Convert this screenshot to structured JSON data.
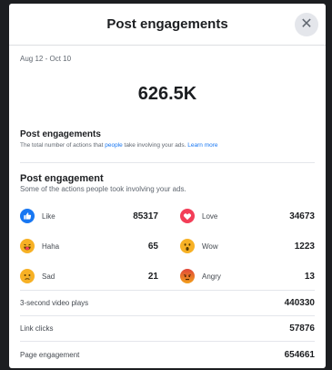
{
  "modal": {
    "title": "Post engagements",
    "close_icon": "close-icon",
    "date_range": "Aug 12 - Oct 10",
    "total": "626.5K"
  },
  "section1": {
    "title": "Post engagements",
    "desc_prefix": "The total number of actions that ",
    "desc_link": "people",
    "desc_suffix": " take involving your ads. ",
    "learn_more": "Learn more"
  },
  "section2": {
    "title": "Post engagement",
    "desc": "Some of the actions people took involving your ads."
  },
  "reactions": [
    {
      "label": "Like",
      "value": "85317",
      "icon": "like-icon"
    },
    {
      "label": "Love",
      "value": "34673",
      "icon": "love-icon"
    },
    {
      "label": "Haha",
      "value": "65",
      "icon": "haha-icon"
    },
    {
      "label": "Wow",
      "value": "1223",
      "icon": "wow-icon"
    },
    {
      "label": "Sad",
      "value": "21",
      "icon": "sad-icon"
    },
    {
      "label": "Angry",
      "value": "13",
      "icon": "angry-icon"
    }
  ],
  "stats": [
    {
      "label": "3-second video plays",
      "value": "440330"
    },
    {
      "label": "Link clicks",
      "value": "57876"
    },
    {
      "label": "Page engagement",
      "value": "654661"
    }
  ],
  "colors": {
    "accent": "#1877f2",
    "like": "#1877f2",
    "love": "#f33e58",
    "emoji": "#f7b125",
    "angry": "#e9710f"
  }
}
